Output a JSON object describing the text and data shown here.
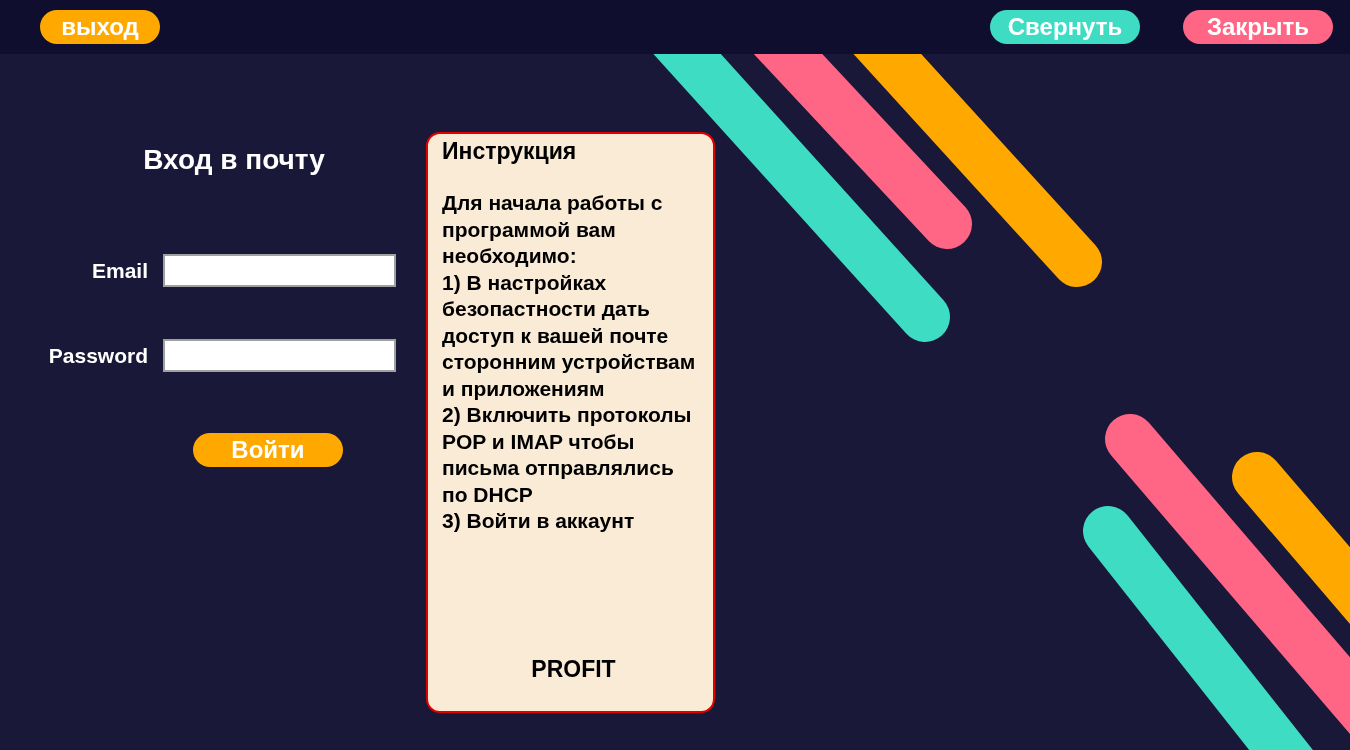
{
  "top_bar": {
    "exit_button": "выход",
    "minimize_button": "Свернуть",
    "close_button": "Закрыть"
  },
  "login": {
    "title": "Вход в почту",
    "fields": [
      {
        "label": "Email"
      },
      {
        "label": "Password"
      }
    ],
    "submit_button": "Войти"
  },
  "instructions": {
    "title": "Инструкция",
    "lines": [
      "Для начала работы с программой вам необходимо:",
      "1) В настройках безопастности дать доступ к вашей почте сторонним устройствам и приложениям",
      "2) Включить протоколы POP и IMAP чтобы письма отправлялись по DHCP",
      "3) Войти в аккаунт"
    ],
    "footer": "PROFIT"
  }
}
